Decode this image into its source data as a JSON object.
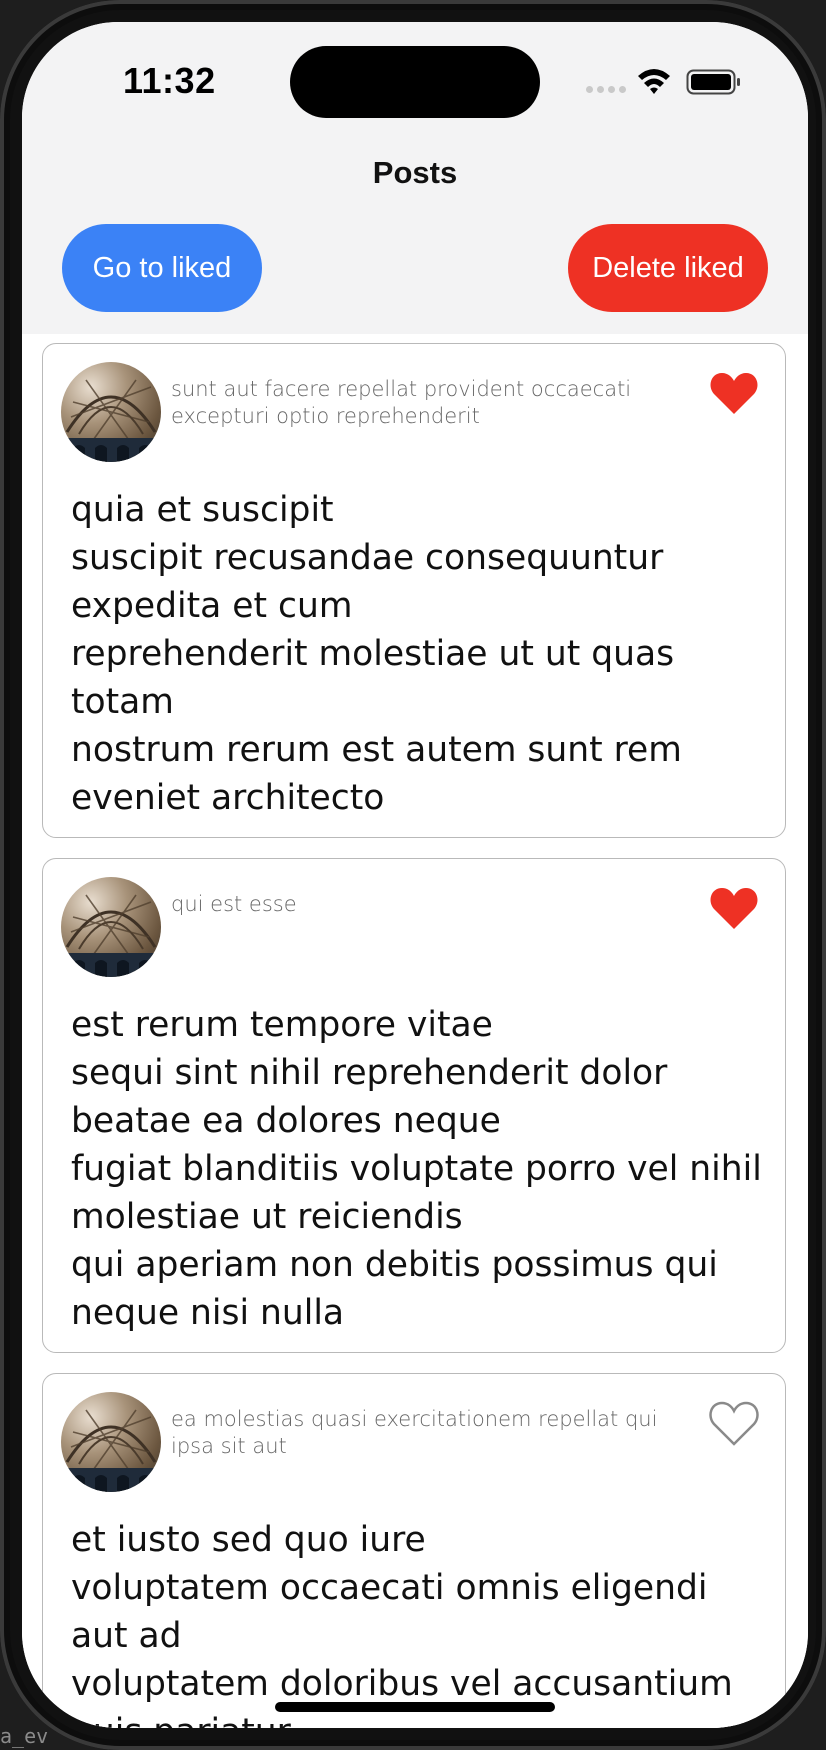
{
  "status_bar": {
    "time": "11:32"
  },
  "header": {
    "title": "Posts",
    "go_to_liked": "Go to liked",
    "delete_liked": "Delete liked"
  },
  "posts": [
    {
      "title": "sunt aut facere repellat provident occaecati excepturi optio reprehenderit",
      "body": "quia et suscipit\nsuscipit recusandae consequuntur expedita et cum\nreprehenderit molestiae ut ut quas totam\nnostrum rerum est autem sunt rem eveniet architecto",
      "liked": true
    },
    {
      "title": "qui est esse",
      "body": "est rerum tempore vitae\nsequi sint nihil reprehenderit dolor beatae ea dolores neque\nfugiat blanditiis voluptate porro vel nihil molestiae ut reiciendis\nqui aperiam non debitis possimus qui neque nisi nulla",
      "liked": true
    },
    {
      "title": "ea molestias quasi exercitationem repellat qui ipsa sit aut",
      "body": "et iusto sed quo iure\nvoluptatem occaecati omnis eligendi aut ad\nvoluptatem doloribus vel accusantium quis pariatur",
      "liked": false
    }
  ],
  "icons": {
    "heart_filled": "heart-filled-icon",
    "heart_outline": "heart-outline-icon",
    "wifi": "wifi-icon",
    "battery": "battery-icon",
    "signal": "signal-icon"
  },
  "colors": {
    "primary_button": "#3b82f6",
    "danger_button": "#ee3124",
    "liked_heart": "#ee3124",
    "unliked_heart": "#8a8a8a"
  },
  "background_code_fragment": "a_ev"
}
